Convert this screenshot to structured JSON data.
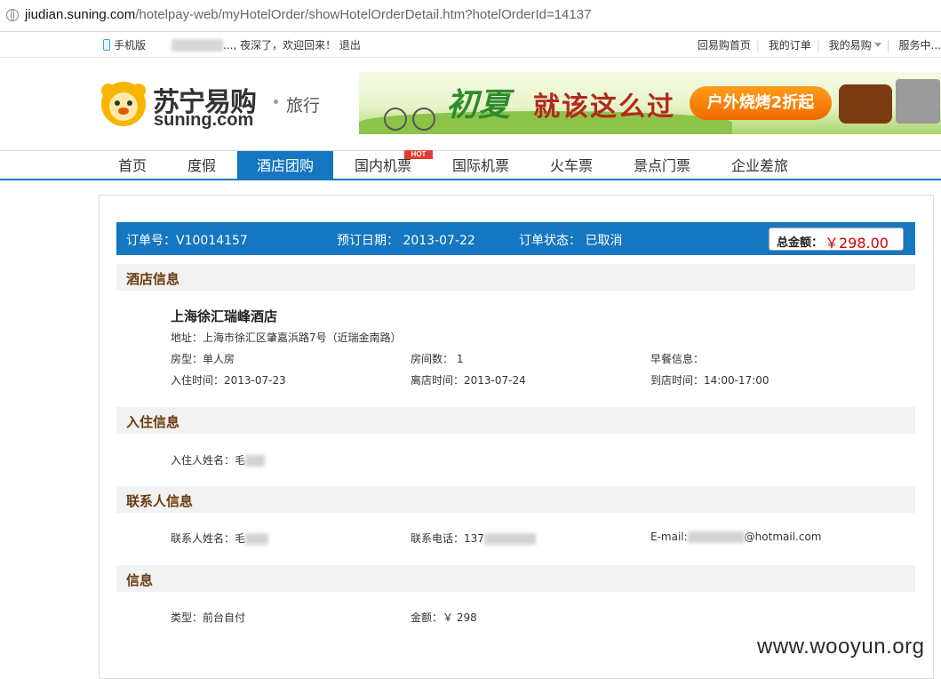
{
  "browser": {
    "url_domain": "jiudian.suning.com",
    "url_path": "/hotelpay-web/myHotelOrder/showHotelOrderDetail.htm?hotelOrderId=14137"
  },
  "topbar": {
    "mobile_label": "手机版",
    "greeting": "..., 夜深了，欢迎回来！",
    "logout": "退出",
    "links": [
      "回易购首页",
      "我的订单",
      "我的易购",
      "服务中..."
    ]
  },
  "logo": {
    "cn": "苏宁易购",
    "en": "suning.com",
    "travel": "旅行"
  },
  "banner": {
    "title_a": "初夏",
    "title_b": "就该这么过",
    "promo": "户外烧烤2折起"
  },
  "nav": {
    "items": [
      "首页",
      "度假",
      "酒店团购",
      "国内机票",
      "国际机票",
      "火车票",
      "景点门票",
      "企业差旅"
    ],
    "hot_badge": "HOT"
  },
  "order": {
    "number": "订单号：V10014157",
    "date": "预订日期：  2013-07-22",
    "status": "订单状态：  已取消",
    "total_label": "总金额：",
    "total_value": "￥298.00"
  },
  "hotel": {
    "section_title": "酒店信息",
    "name": "上海徐汇瑞峰酒店",
    "address": "地址：上海市徐汇区肇嘉浜路7号（近瑞金南路）",
    "room_type": "房型：单人房",
    "room_count": "房间数：  1",
    "breakfast": "早餐信息：",
    "checkin": "入住时间：2013-07-23",
    "checkout": "离店时间：2013-07-24",
    "arrival": "到店时间：14:00-17:00"
  },
  "guest": {
    "section_title": "入住信息",
    "name_label": "入住人姓名：毛"
  },
  "contact": {
    "section_title": "联系人信息",
    "name_label": "联系人姓名：毛",
    "phone_label": "联系电话：137",
    "email_label": "E-mail:",
    "email_domain": "@hotmail.com"
  },
  "payment": {
    "section_title": "信息",
    "type": "类型：前台自付",
    "amount": "金额：￥ 298"
  },
  "watermark": "www.wooyun.org"
}
